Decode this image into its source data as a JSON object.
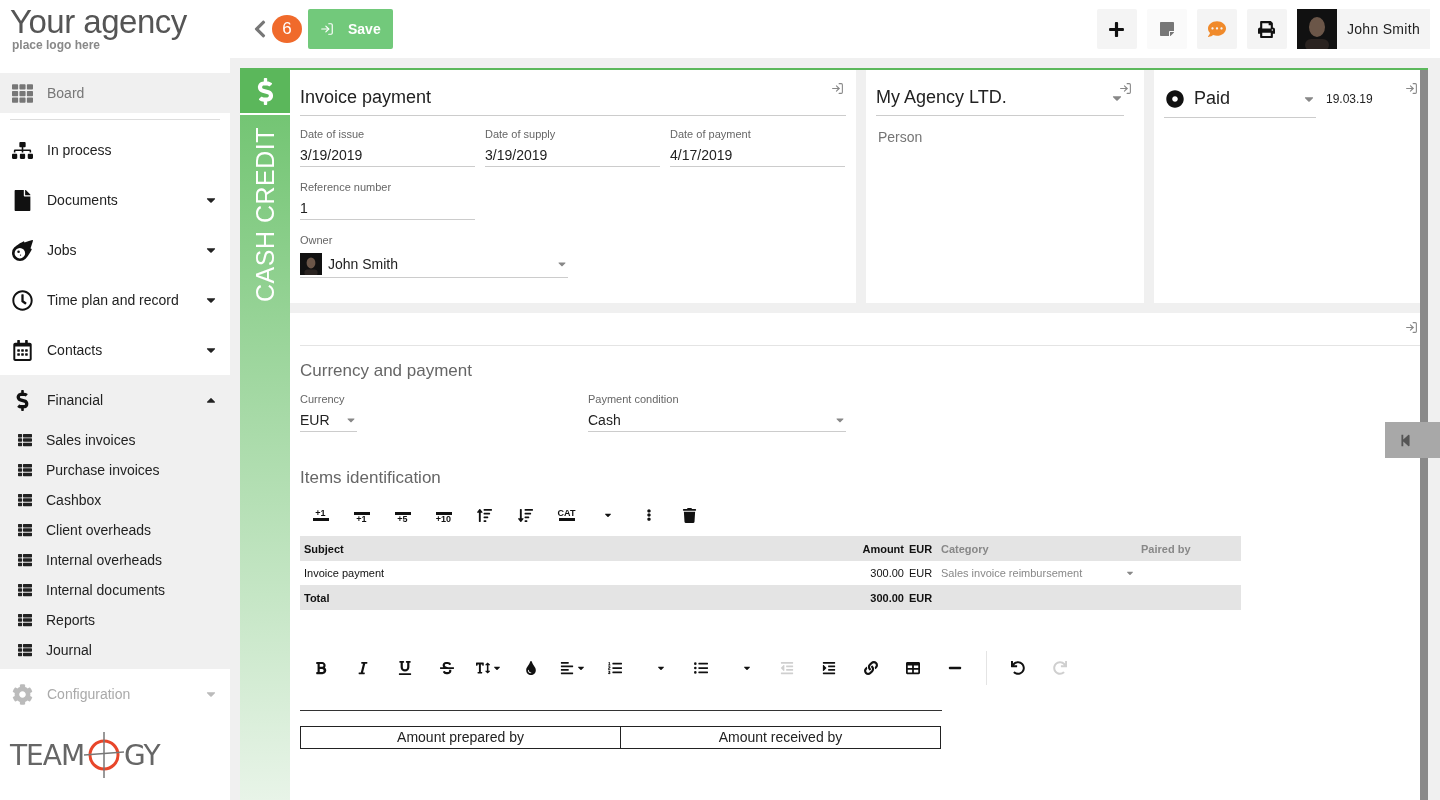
{
  "header": {
    "badge": "6",
    "save": "Save",
    "user": "John Smith"
  },
  "sidebar": {
    "logo": {
      "title": "Your agency",
      "subtitle": "place logo here"
    },
    "items": [
      {
        "label": "Board",
        "selected": true,
        "disabled": false
      },
      {
        "label": "In process",
        "selected": false,
        "disabled": false
      },
      {
        "label": "Documents",
        "selected": false,
        "disabled": false,
        "expanded": false
      },
      {
        "label": "Jobs",
        "selected": false,
        "disabled": false,
        "expanded": false
      },
      {
        "label": "Time plan and record",
        "selected": false,
        "disabled": false,
        "expanded": false
      },
      {
        "label": "Contacts",
        "selected": false,
        "disabled": false,
        "expanded": false
      },
      {
        "label": "Financial",
        "selected": false,
        "disabled": false,
        "expanded": true,
        "children": [
          {
            "label": "Sales invoices"
          },
          {
            "label": "Purchase invoices"
          },
          {
            "label": "Cashbox"
          },
          {
            "label": "Client overheads"
          },
          {
            "label": "Internal overheads"
          },
          {
            "label": "Internal documents"
          },
          {
            "label": "Reports"
          },
          {
            "label": "Journal"
          }
        ]
      },
      {
        "label": "Configuration",
        "selected": false,
        "disabled": true,
        "expanded": false
      }
    ],
    "brand": {
      "left": "TEAM",
      "right": "GY"
    }
  },
  "document": {
    "type": "CASH CREDIT",
    "title": "Invoice payment",
    "fields": [
      {
        "label": "Date of issue",
        "value": "3/19/2019"
      },
      {
        "label": "Date of supply",
        "value": "3/19/2019"
      },
      {
        "label": "Date of payment",
        "value": "4/17/2019"
      },
      {
        "label": "Reference number",
        "value": "1"
      }
    ],
    "owner": {
      "label": "Owner",
      "value": "John Smith"
    },
    "company": {
      "value": "My Agency LTD.",
      "person_placeholder": "Person"
    },
    "status": {
      "value": "Paid",
      "date": "19.03.19"
    }
  },
  "payment": {
    "heading": "Currency and payment",
    "currency": {
      "label": "Currency",
      "value": "EUR"
    },
    "condition": {
      "label": "Payment condition",
      "value": "Cash"
    }
  },
  "items": {
    "heading": "Items identification",
    "toolbar": [
      {
        "kind": "insert-above",
        "label": "+1"
      },
      {
        "kind": "insert",
        "label": "+1"
      },
      {
        "kind": "insert",
        "label": "+5"
      },
      {
        "kind": "insert",
        "label": "+10"
      },
      {
        "kind": "move-up"
      },
      {
        "kind": "move-down"
      },
      {
        "kind": "insert-above",
        "label": "CAT"
      },
      {
        "kind": "expand"
      },
      {
        "kind": "more"
      },
      {
        "kind": "delete"
      }
    ],
    "columns": [
      {
        "label": "Subject",
        "muted": false
      },
      {
        "label": "Amount",
        "muted": false
      },
      {
        "label": "EUR",
        "muted": false
      },
      {
        "label": "Category",
        "muted": true
      },
      {
        "label": "Paired by",
        "muted": true
      }
    ],
    "rows": [
      {
        "subject": "Invoice payment",
        "amount": "300.00",
        "currency": "EUR",
        "category": "Sales invoice reimbursement"
      }
    ],
    "total": {
      "label": "Total",
      "amount": "300.00",
      "currency": "EUR"
    }
  },
  "editor": {
    "toolbar": [
      {
        "kind": "bold",
        "disabled": false
      },
      {
        "kind": "italic",
        "disabled": false
      },
      {
        "kind": "underline",
        "disabled": false
      },
      {
        "kind": "strike",
        "disabled": false
      },
      {
        "kind": "size",
        "disabled": false
      },
      {
        "kind": "color",
        "disabled": false
      },
      {
        "kind": "align",
        "disabled": false
      },
      {
        "kind": "ol",
        "disabled": false
      },
      {
        "kind": "ul",
        "disabled": false
      },
      {
        "kind": "outdent",
        "disabled": true
      },
      {
        "kind": "indent",
        "disabled": false
      },
      {
        "kind": "link",
        "disabled": false
      },
      {
        "kind": "table",
        "disabled": false
      },
      {
        "kind": "hr",
        "disabled": false
      },
      {
        "kind": "undo",
        "disabled": false
      },
      {
        "kind": "redo",
        "disabled": true
      }
    ],
    "signatures": [
      "Amount prepared by",
      "Amount received by"
    ]
  }
}
